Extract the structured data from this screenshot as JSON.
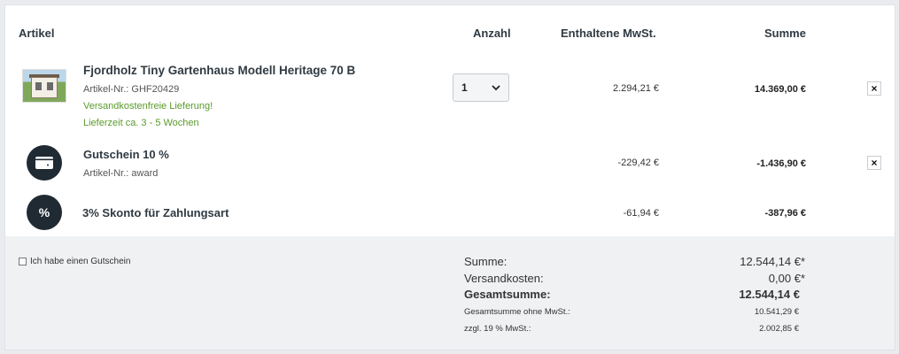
{
  "header": {
    "col_article": "Artikel",
    "col_qty": "Anzahl",
    "col_vat": "Enthaltene MwSt.",
    "col_sum": "Summe"
  },
  "items": [
    {
      "name": "Fjordholz Tiny Gartenhaus Modell Heritage 70 B",
      "sku": "Artikel-Nr.: GHF20429",
      "shipping_note": "Versandkostenfreie Lieferung!",
      "delivery_note": "Lieferzeit ca. 3 - 5 Wochen",
      "quantity": "1",
      "vat": "2.294,21 €",
      "total": "14.369,00 €",
      "remove": "×",
      "icon": "product-thumbnail"
    },
    {
      "name": "Gutschein 10 %",
      "sku": "Artikel-Nr.: award",
      "vat": "-229,42 €",
      "total": "-1.436,90 €",
      "remove": "×",
      "icon": "voucher-card-icon"
    },
    {
      "name": "3% Skonto für Zahlungsart",
      "vat": "-61,94 €",
      "total": "-387,96 €",
      "icon_text": "%",
      "icon": "percent-icon"
    }
  ],
  "voucher_checkbox_label": "Ich habe einen Gutschein",
  "summary": {
    "subtotal_label": "Summe:",
    "subtotal_value": "12.544,14 €*",
    "shipping_label": "Versandkosten:",
    "shipping_value": "0,00 €*",
    "grand_total_label": "Gesamtsumme:",
    "grand_total_value": "12.544,14 €",
    "net_label": "Gesamtsumme ohne MwSt.:",
    "net_value": "10.541,29 €",
    "vat_label": "zzgl. 19 % MwSt.:",
    "vat_value": "2.002,85 €"
  }
}
